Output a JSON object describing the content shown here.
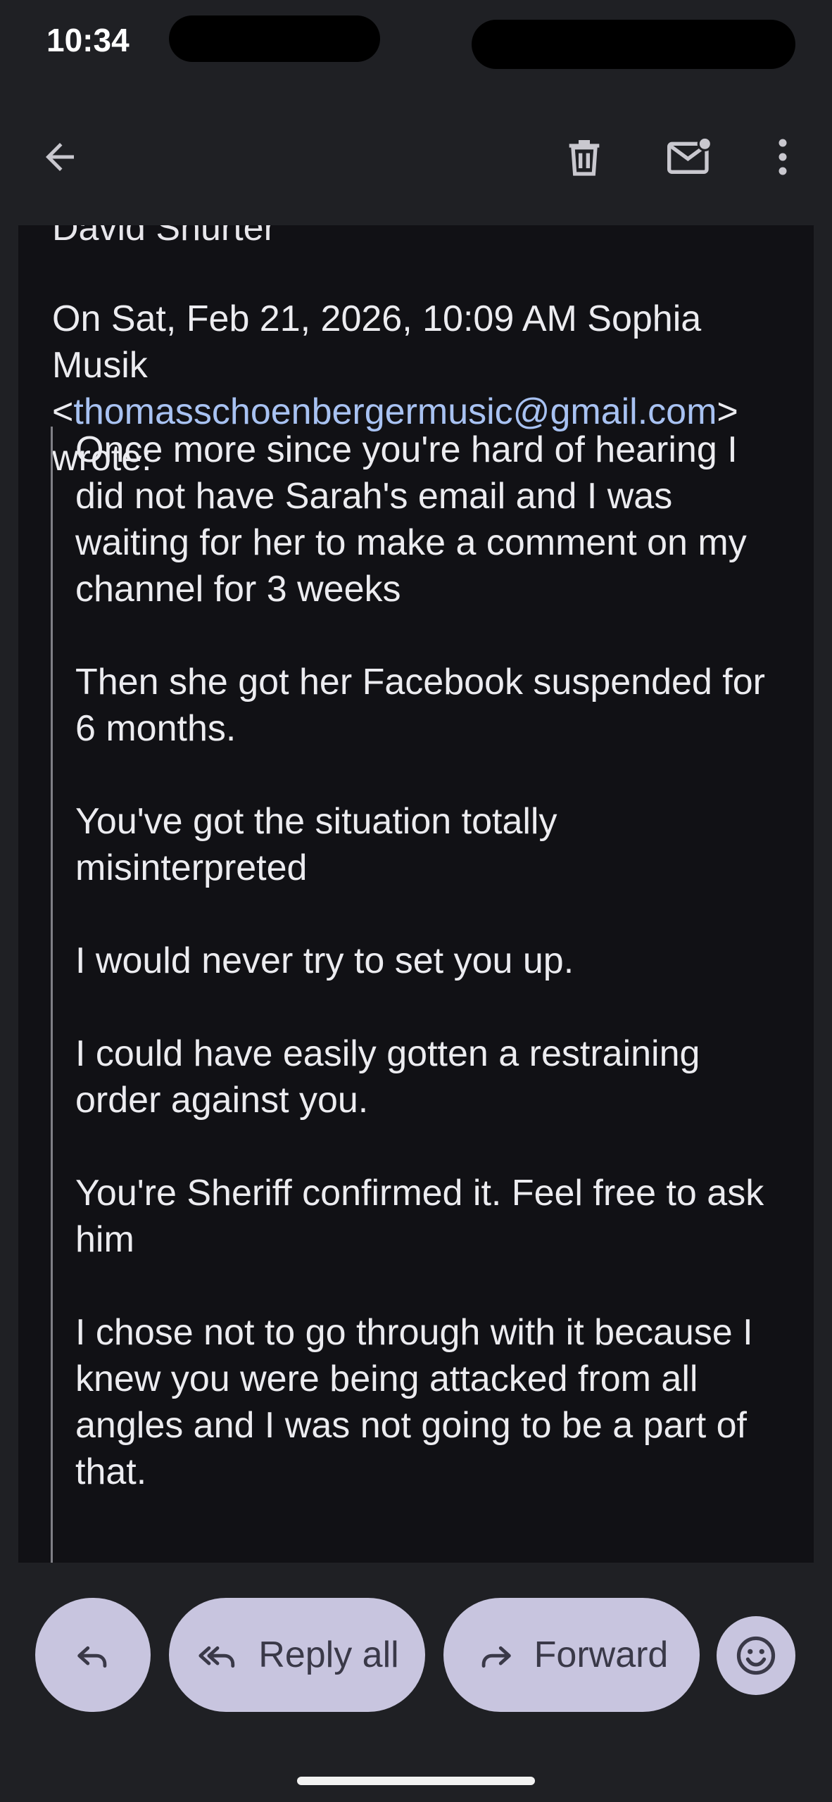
{
  "status_bar": {
    "time": "10:34"
  },
  "toolbar": {
    "back_icon": "arrow-left-icon",
    "delete_icon": "trash-icon",
    "mark_unread_icon": "mail-unread-icon",
    "more_icon": "more-vertical-icon"
  },
  "email": {
    "signature_name": "David Shurter",
    "attribution_prefix": "On Sat, Feb 21, 2026, 10:09 AM Sophia Musik <",
    "attribution_email": "thomasschoenbergermusic@gmail.com",
    "attribution_suffix": "> wrote:",
    "quoted_paragraphs": [
      "Once more since you're hard of hearing I did not have Sarah's email and I was waiting for her to make a comment on my channel for 3 weeks",
      "Then she got her Facebook suspended for 6 months.",
      "You've got the situation totally misinterpreted",
      "I would never try to set you up.",
      "I could have easily gotten a restraining order against you.",
      "You're Sheriff confirmed it. Feel free to ask him",
      "I chose not to go through with it because I knew you were being attacked from all angles and I was not going to be a part of that."
    ]
  },
  "actions": {
    "reply_icon": "reply-icon",
    "reply_all_label": "Reply all",
    "reply_all_icon": "reply-all-icon",
    "forward_label": "Forward",
    "forward_icon": "forward-icon",
    "emoji_icon": "emoji-smile-icon"
  },
  "colors": {
    "background": "#1f2024",
    "mail_body": "#111115",
    "link": "#a8c2f2",
    "pill": "#c8c5df"
  }
}
